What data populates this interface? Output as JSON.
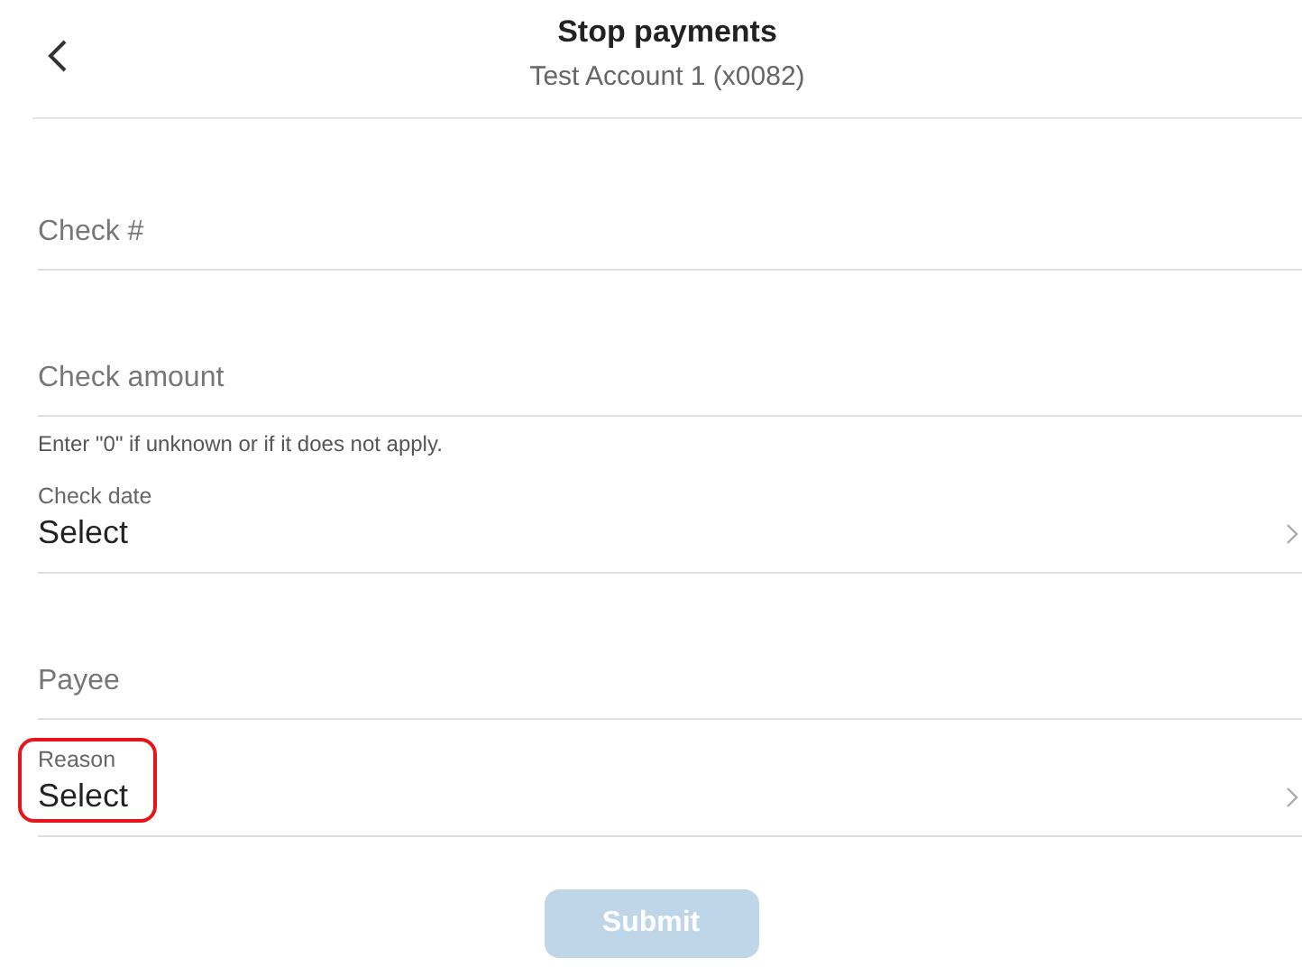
{
  "header": {
    "title": "Stop payments",
    "subtitle": "Test Account 1 (x0082)"
  },
  "fields": [
    {
      "kind": "text",
      "placeholder": "Check #"
    },
    {
      "kind": "text",
      "placeholder": "Check amount",
      "hint": "Enter \"0\" if unknown or if it does not apply."
    },
    {
      "kind": "select",
      "label": "Check date",
      "value": "Select",
      "highlighted": false
    },
    {
      "kind": "text",
      "placeholder": "Payee"
    },
    {
      "kind": "select",
      "label": "Reason",
      "value": "Select",
      "highlighted": true
    }
  ],
  "submit": {
    "label": "Submit",
    "disabled": true
  }
}
